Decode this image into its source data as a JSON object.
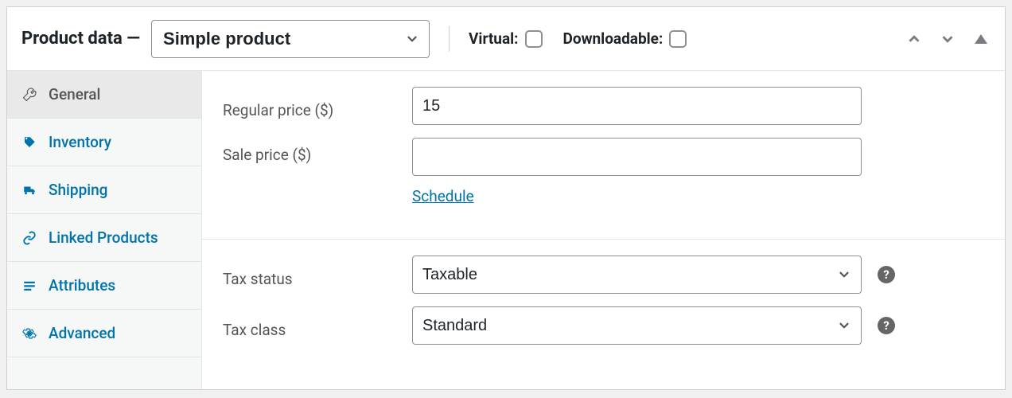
{
  "header": {
    "title": "Product data —",
    "product_type": "Simple product",
    "virtual_label": "Virtual:",
    "downloadable_label": "Downloadable:"
  },
  "sidebar": {
    "items": [
      {
        "label": "General"
      },
      {
        "label": "Inventory"
      },
      {
        "label": "Shipping"
      },
      {
        "label": "Linked Products"
      },
      {
        "label": "Attributes"
      },
      {
        "label": "Advanced"
      }
    ]
  },
  "general": {
    "regular_price_label": "Regular price ($)",
    "regular_price_value": "15",
    "sale_price_label": "Sale price ($)",
    "sale_price_value": "",
    "schedule_label": "Schedule",
    "tax_status_label": "Tax status",
    "tax_status_value": "Taxable",
    "tax_class_label": "Tax class",
    "tax_class_value": "Standard",
    "help_glyph": "?"
  }
}
